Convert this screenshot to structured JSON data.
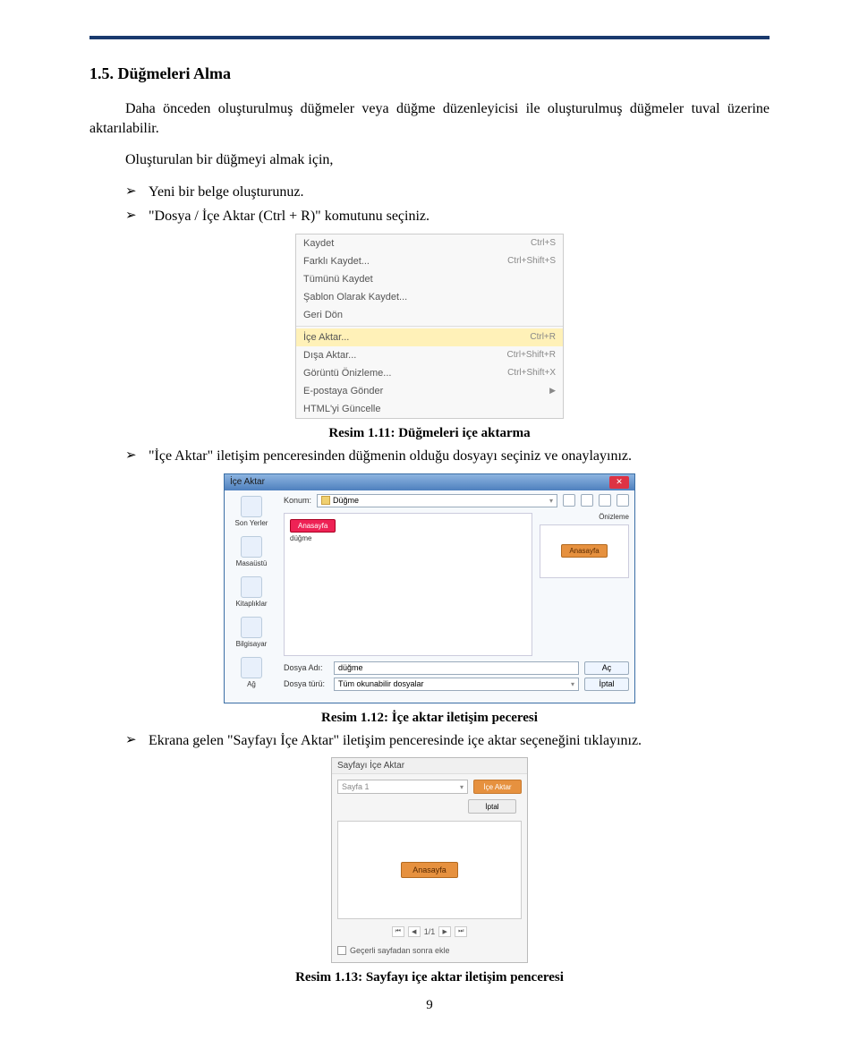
{
  "heading": "1.5. Düğmeleri Alma",
  "para1": "Daha önceden oluşturulmuş düğmeler veya düğme düzenleyicisi ile oluşturulmuş düğmeler tuval üzerine aktarılabilir.",
  "para2": "Oluşturulan bir düğmeyi almak için,",
  "bul1": "Yeni bir belge oluşturunuz.",
  "bul2": "\"Dosya / İçe Aktar (Ctrl + R)\" komutunu seçiniz.",
  "fig1": {
    "caption": "Resim 1.11: Düğmeleri içe aktarma",
    "rows": [
      {
        "label": "Kaydet",
        "short": "Ctrl+S",
        "sel": false
      },
      {
        "label": "Farklı Kaydet...",
        "short": "Ctrl+Shift+S",
        "sel": false
      },
      {
        "label": "Tümünü Kaydet",
        "short": "",
        "sel": false
      },
      {
        "label": "Şablon Olarak Kaydet...",
        "short": "",
        "sel": false
      },
      {
        "label": "Geri Dön",
        "short": "",
        "sel": false
      },
      {
        "hr": true
      },
      {
        "label": "İçe Aktar...",
        "short": "Ctrl+R",
        "sel": true
      },
      {
        "label": "Dışa Aktar...",
        "short": "Ctrl+Shift+R",
        "sel": false
      },
      {
        "label": "Görüntü Önizleme...",
        "short": "Ctrl+Shift+X",
        "sel": false
      },
      {
        "label": "E-postaya Gönder",
        "short": "",
        "sel": false,
        "sub": true
      },
      {
        "label": "HTML'yi Güncelle",
        "short": "",
        "sel": false
      }
    ]
  },
  "bul3": "\"İçe Aktar\" iletişim penceresinden düğmenin olduğu dosyayı seçiniz ve onaylayınız.",
  "fig2": {
    "caption": "Resim 1.12: İçe aktar iletişim peceresi",
    "title": "İçe Aktar",
    "konum_label": "Konum:",
    "konum_value": "Düğme",
    "side": [
      "Son Yerler",
      "Masaüstü",
      "Kitaplıklar",
      "Bilgisayar",
      "Ağ"
    ],
    "file_badge": "Anasayfa",
    "file_name": "düğme",
    "preview_label": "Önizleme",
    "preview_badge": "Anasayfa",
    "dosya_adi_label": "Dosya Adı:",
    "dosya_adi_value": "düğme",
    "dosya_turu_label": "Dosya türü:",
    "dosya_turu_value": "Tüm okunabilir dosyalar",
    "btn_open": "Aç",
    "btn_cancel": "İptal"
  },
  "bul4": "Ekrana gelen \"Sayfayı İçe Aktar\" iletişim penceresinde içe aktar seçeneğini tıklayınız.",
  "fig3": {
    "caption": "Resim 1.13: Sayfayı içe aktar iletişim penceresi",
    "title": "Sayfayı İçe Aktar",
    "select": "Sayfa 1",
    "btn_import": "İçe Aktar",
    "btn_cancel": "İptal",
    "preview_badge": "Anasayfa",
    "pager": "1/1",
    "checkbox": "Geçerli sayfadan sonra ekle"
  },
  "pagenum": "9"
}
